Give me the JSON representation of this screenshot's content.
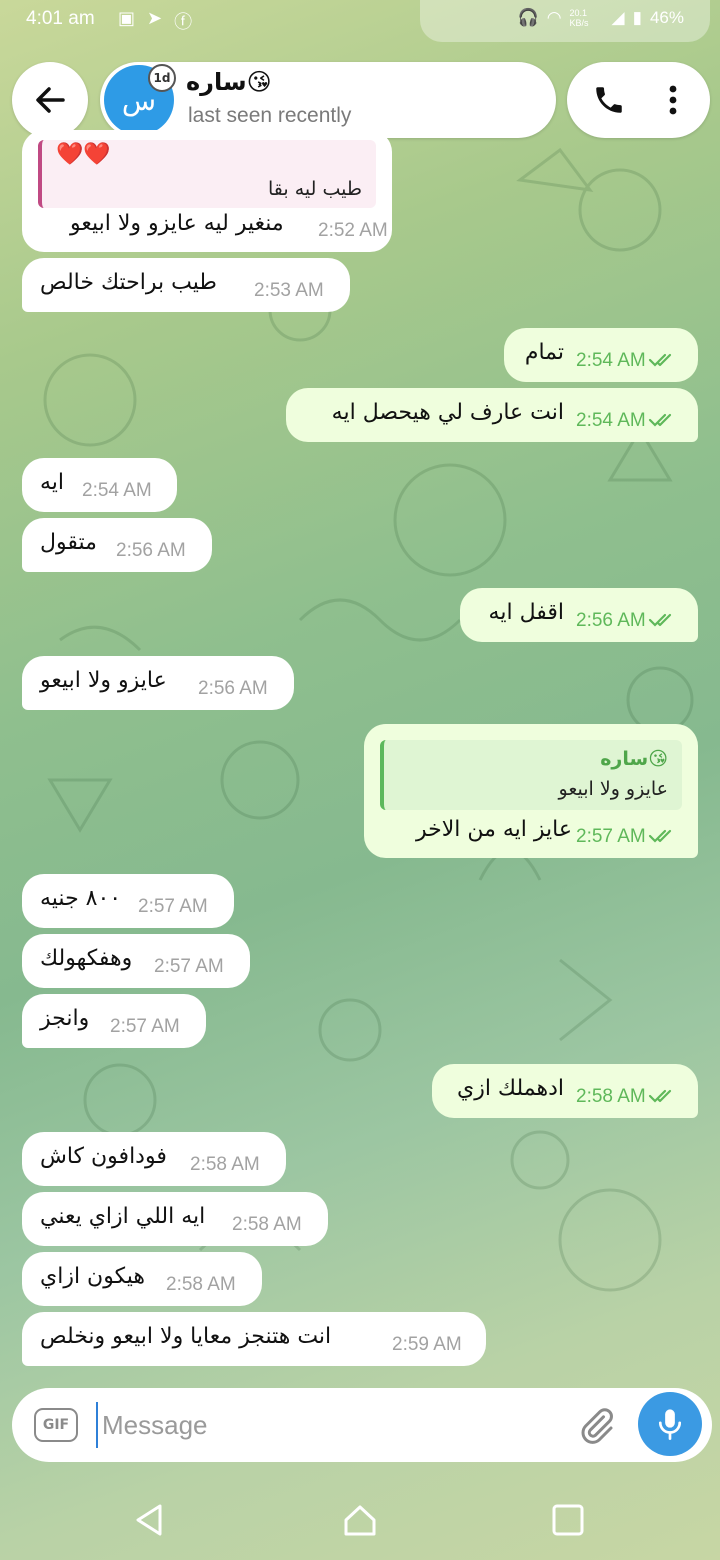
{
  "status_bar": {
    "time": "4:01 am",
    "battery": "46%",
    "net_speed": "20.1 KB/s"
  },
  "header": {
    "back_label": "←",
    "avatar_letter": "س",
    "story_badge": "1d",
    "name": "ساره😘",
    "status": "last seen recently"
  },
  "messages": [
    {
      "dir": "in",
      "reply": {
        "emoji": "❤️❤️",
        "text": "طيب ليه بقا"
      },
      "text": "منغير ليه عايزو ولا ابيعو",
      "time": "2:52 AM"
    },
    {
      "dir": "in",
      "text": "طيب براحتك خالص",
      "time": "2:53 AM"
    },
    {
      "dir": "out",
      "text": "تمام",
      "time": "2:54 AM"
    },
    {
      "dir": "out",
      "text": "انت عارف لي هيحصل ايه",
      "time": "2:54 AM"
    },
    {
      "dir": "in",
      "text": "ايه",
      "time": "2:54 AM"
    },
    {
      "dir": "in",
      "text": "متقول",
      "time": "2:56 AM"
    },
    {
      "dir": "out",
      "text": "اقفل ايه",
      "time": "2:56 AM"
    },
    {
      "dir": "in",
      "text": "عايزو ولا ابيعو",
      "time": "2:56 AM"
    },
    {
      "dir": "out",
      "reply": {
        "name": "ساره😘",
        "text": "عايزو ولا ابيعو"
      },
      "text": "عايز ايه من الاخر",
      "time": "2:57 AM"
    },
    {
      "dir": "in",
      "text": "٨٠٠ جنيه",
      "time": "2:57 AM"
    },
    {
      "dir": "in",
      "text": "وهفكهولك",
      "time": "2:57 AM"
    },
    {
      "dir": "in",
      "text": "وانجز",
      "time": "2:57 AM"
    },
    {
      "dir": "out",
      "text": "ادهملك ازي",
      "time": "2:58 AM"
    },
    {
      "dir": "in",
      "text": "فودافون كاش",
      "time": "2:58 AM"
    },
    {
      "dir": "in",
      "text": "ايه اللي ازاي يعني",
      "time": "2:58 AM"
    },
    {
      "dir": "in",
      "text": "هيكون ازاي",
      "time": "2:58 AM"
    },
    {
      "dir": "in",
      "text": "انت هتنجز معايا ولا ابيعو ونخلص",
      "time": "2:59 AM"
    }
  ],
  "composer": {
    "gif_label": "GIF",
    "placeholder": "Message"
  },
  "colors": {
    "incoming_bubble": "#ffffff",
    "outgoing_bubble": "#effedd",
    "accent": "#3b9ae3",
    "read_check": "#5fb85a"
  }
}
